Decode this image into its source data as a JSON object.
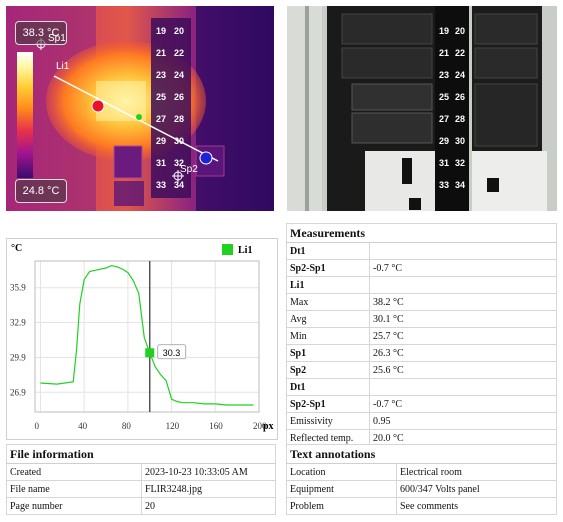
{
  "thermal": {
    "max_temp": "38.3 °C",
    "min_temp": "24.8 °C",
    "line_label": "Li1",
    "spot1_label": "Sp1",
    "spot2_label": "Sp2",
    "breaker_numbers": [
      "19",
      "20",
      "21",
      "22",
      "23",
      "24",
      "25",
      "26",
      "27",
      "28",
      "29",
      "30",
      "31",
      "32",
      "33",
      "34"
    ]
  },
  "visual": {
    "breaker_numbers": [
      "19",
      "20",
      "21",
      "22",
      "23",
      "24",
      "25",
      "26",
      "27",
      "28",
      "29",
      "30",
      "31",
      "32",
      "33",
      "34"
    ]
  },
  "chart_data": {
    "type": "line",
    "ylabel": "°C",
    "xlabel": "px",
    "xlim": [
      -5,
      200
    ],
    "ylim": [
      25.2,
      38.2
    ],
    "xticks": [
      "0",
      "40",
      "80",
      "120",
      "160",
      "200"
    ],
    "yticks": [
      "26.9",
      "29.9",
      "32.9",
      "35.9"
    ],
    "legend": "Li1",
    "marker": {
      "x": 100,
      "y": 30.3,
      "label": "30.3"
    },
    "series": [
      {
        "name": "Li1",
        "x": [
          0,
          15,
          30,
          33,
          36,
          40,
          45,
          50,
          55,
          60,
          65,
          70,
          75,
          80,
          85,
          90,
          95,
          100,
          105,
          110,
          115,
          120,
          125,
          130,
          140,
          150,
          160,
          170,
          180,
          190,
          195
        ],
        "y": [
          27.7,
          27.6,
          27.8,
          30.5,
          34.5,
          36.6,
          37.3,
          37.4,
          37.5,
          37.6,
          37.8,
          37.7,
          37.5,
          37.2,
          36.5,
          35.4,
          31.6,
          30.3,
          29.1,
          28.4,
          27.9,
          26.3,
          26.1,
          26.0,
          26.0,
          25.9,
          25.9,
          25.8,
          25.8,
          25.8,
          25.8
        ]
      }
    ]
  },
  "measurements": {
    "title": "Measurements",
    "rows": [
      {
        "label": "Dt1",
        "value": "",
        "bold": true
      },
      {
        "label": "Sp2-Sp1",
        "value": "-0.7 °C",
        "bold": true
      },
      {
        "label": "Li1",
        "value": "",
        "bold": true
      },
      {
        "label": "Max",
        "value": "38.2 °C",
        "bold": false
      },
      {
        "label": "Avg",
        "value": "30.1 °C",
        "bold": false
      },
      {
        "label": "Min",
        "value": "25.7 °C",
        "bold": false
      },
      {
        "label": "Sp1",
        "value": "26.3 °C",
        "bold": true
      },
      {
        "label": "Sp2",
        "value": "25.6 °C",
        "bold": true
      },
      {
        "label": "Dt1",
        "value": "",
        "bold": true
      },
      {
        "label": "Sp2-Sp1",
        "value": "-0.7 °C",
        "bold": true
      },
      {
        "label": "Emissivity",
        "value": "0.95",
        "bold": false
      },
      {
        "label": "Reflected temp.",
        "value": "20.0 °C",
        "bold": false
      }
    ]
  },
  "file_info": {
    "title": "File information",
    "rows": [
      {
        "label": "Created",
        "value": "2023-10-23 10:33:05 AM"
      },
      {
        "label": "File name",
        "value": "FLIR3248.jpg"
      },
      {
        "label": "Page number",
        "value": "20"
      }
    ]
  },
  "text_annotations": {
    "title": "Text annotations",
    "rows": [
      {
        "label": "Location",
        "value": "Electrical room"
      },
      {
        "label": "Equipment",
        "value": "600/347 Volts panel"
      },
      {
        "label": "Problem",
        "value": "See comments"
      }
    ]
  }
}
